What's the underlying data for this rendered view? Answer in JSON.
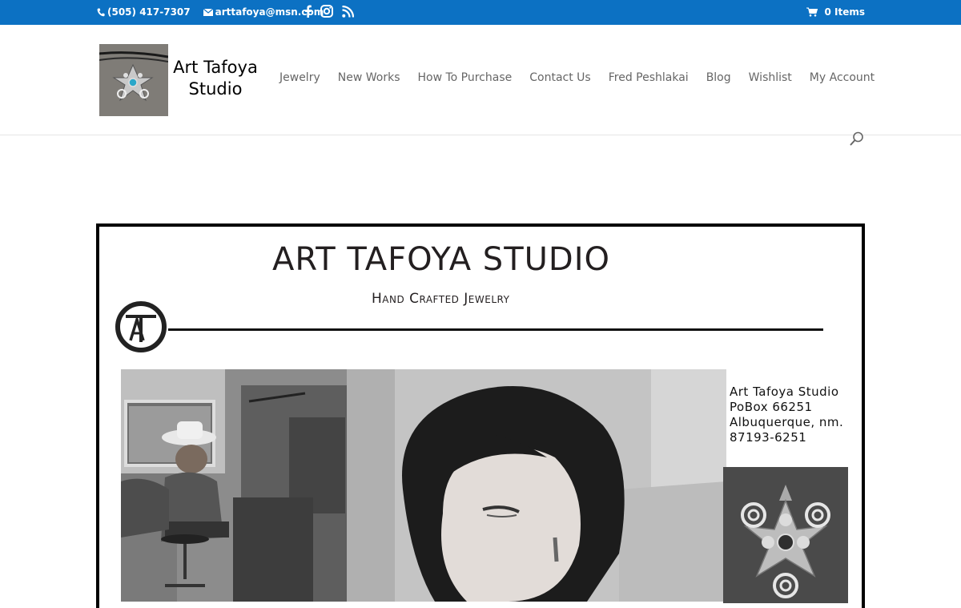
{
  "topbar": {
    "phone": "(505) 417-7307",
    "email": "arttafoya@msn.com",
    "social": [
      "facebook-icon",
      "instagram-icon",
      "rss-icon"
    ],
    "cart": "0 Items",
    "bg_color": "#0c71c3"
  },
  "header": {
    "logo_text": "Art Tafoya Studio",
    "nav": [
      "Jewelry",
      "New Works",
      "How To Purchase",
      "Contact Us",
      "Fred Peshlakai",
      "Blog",
      "Wishlist",
      "My Account"
    ]
  },
  "banner": {
    "title": "ART TAFOYA STUDIO",
    "subtitle": "Hand Crafted Jewelry",
    "monogram": "AT",
    "address": [
      "Art Tafoya Studio",
      "PoBox 66251",
      "Albuquerque, nm.",
      "87193-6251"
    ]
  }
}
